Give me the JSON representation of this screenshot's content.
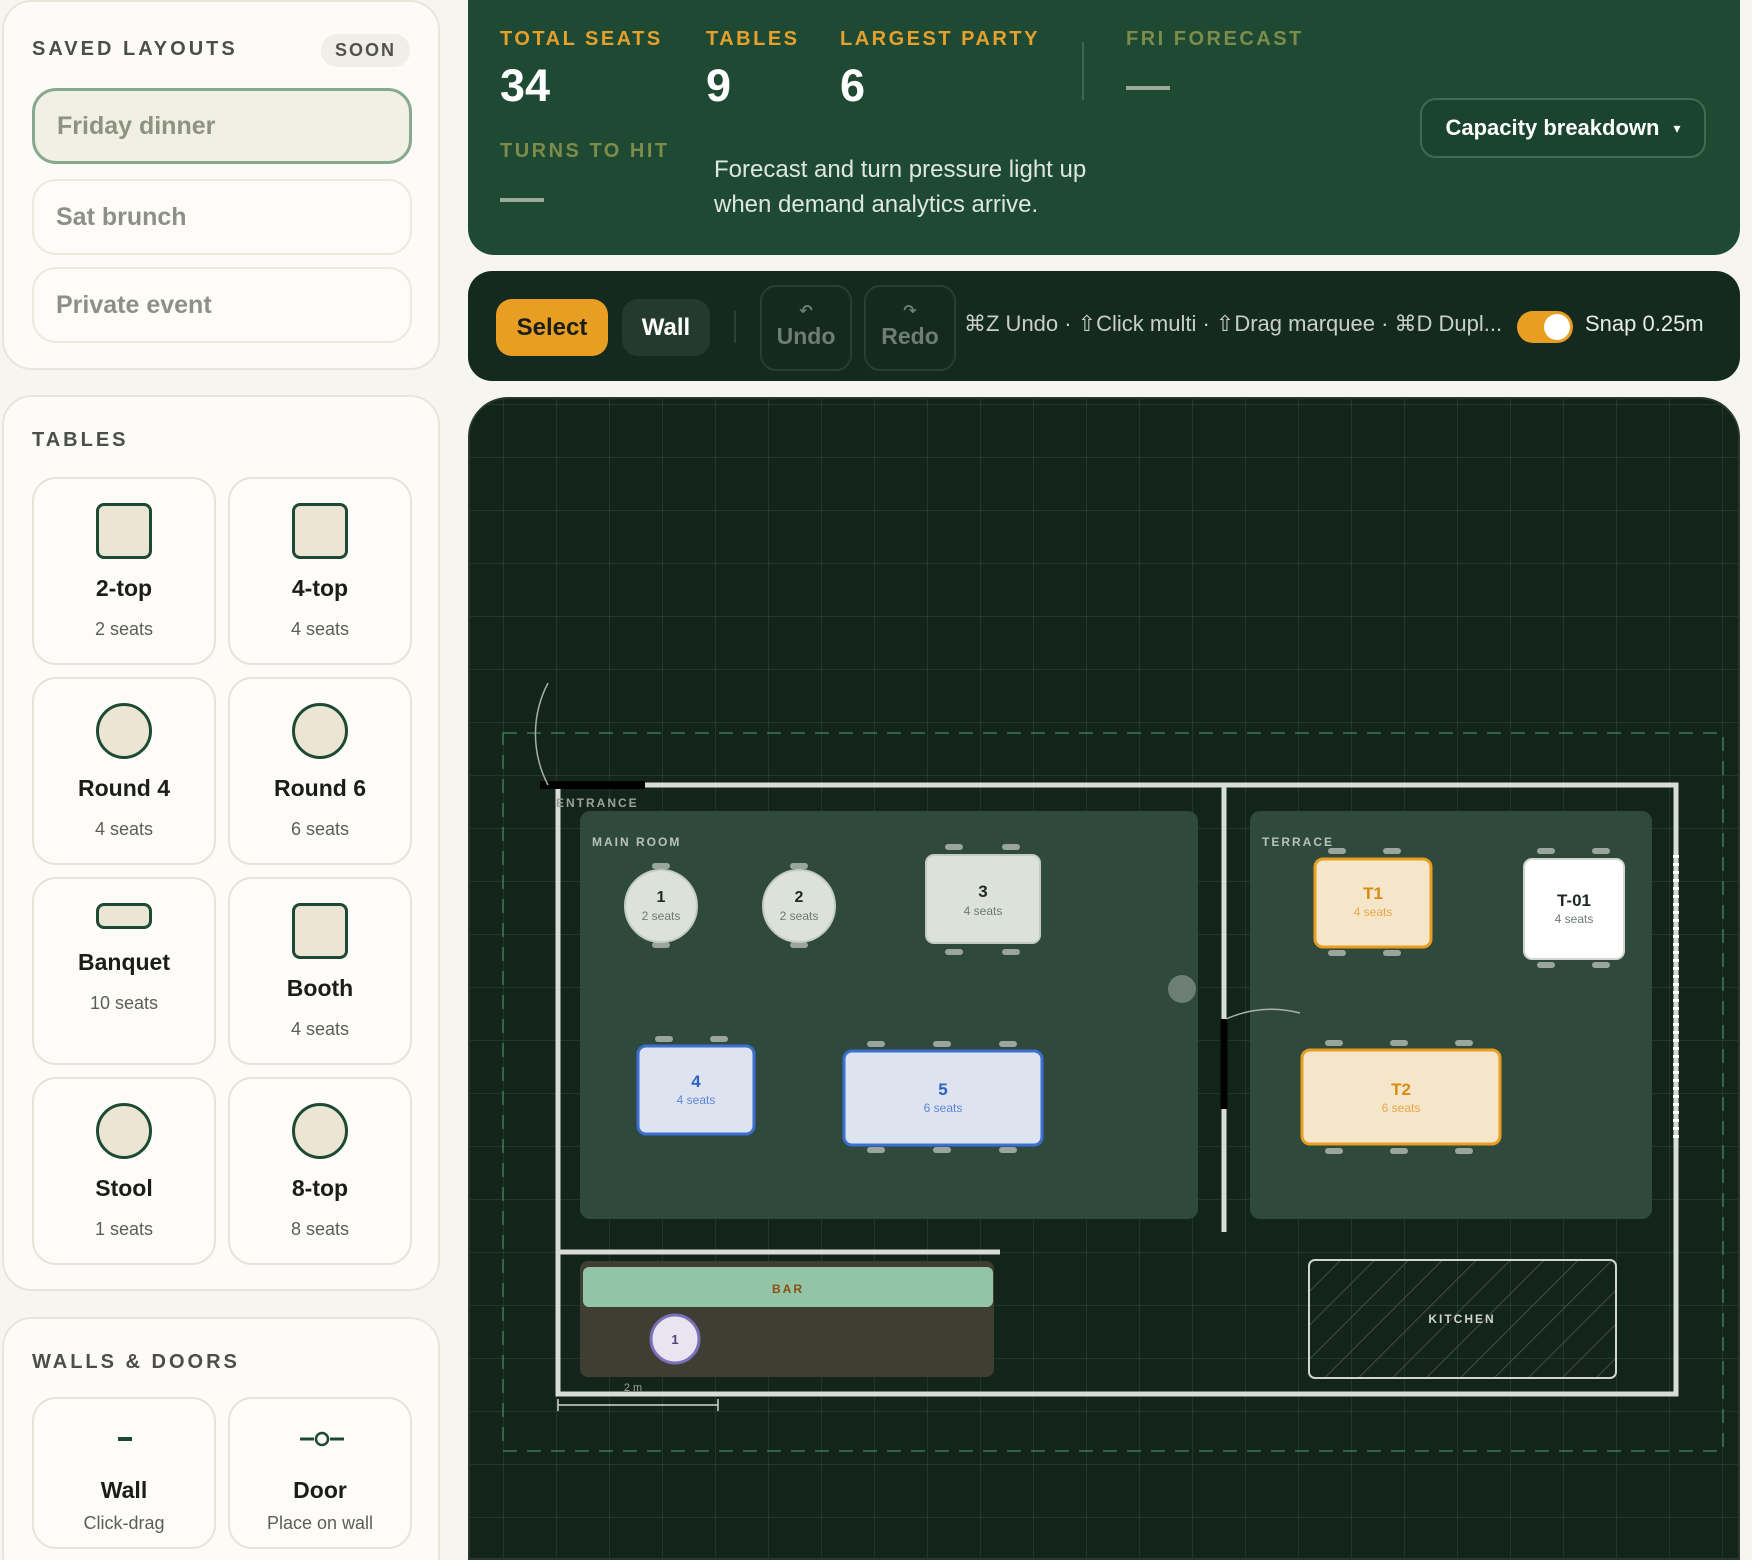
{
  "saved_layouts": {
    "title": "SAVED LAYOUTS",
    "badge": "SOON",
    "items": [
      "Friday dinner",
      "Sat brunch",
      "Private event"
    ]
  },
  "tables_panel": {
    "title": "TABLES",
    "items": [
      {
        "name": "2-top",
        "seats": "2 seats",
        "shape": "square"
      },
      {
        "name": "4-top",
        "seats": "4 seats",
        "shape": "square"
      },
      {
        "name": "Round 4",
        "seats": "4 seats",
        "shape": "round"
      },
      {
        "name": "Round 6",
        "seats": "6 seats",
        "shape": "round"
      },
      {
        "name": "Banquet",
        "seats": "10 seats",
        "shape": "banquet"
      },
      {
        "name": "Booth",
        "seats": "4 seats",
        "shape": "square"
      },
      {
        "name": "Stool",
        "seats": "1 seats",
        "shape": "round"
      },
      {
        "name": "8-top",
        "seats": "8 seats",
        "shape": "round"
      }
    ]
  },
  "walls_panel": {
    "title": "WALLS & DOORS",
    "items": [
      {
        "name": "Wall",
        "sub": "Click-drag",
        "icon": "wall-icon"
      },
      {
        "name": "Door",
        "sub": "Place on wall",
        "icon": "door-icon"
      }
    ]
  },
  "stats": {
    "total_seats_label": "TOTAL SEATS",
    "total_seats": "34",
    "tables_label": "TABLES",
    "tables": "9",
    "largest_party_label": "LARGEST PARTY",
    "largest_party": "6",
    "forecast_label": "FRI FORECAST",
    "turns_label": "TURNS TO HIT",
    "message_line1": "Forecast and turn pressure light up",
    "message_line2": "when demand analytics arrive.",
    "capacity_button": "Capacity breakdown",
    "capacity_caret": "▾"
  },
  "toolbar": {
    "select": "Select",
    "wall": "Wall",
    "undo": "Undo",
    "redo": "Redo",
    "undo_icon": "↶",
    "redo_icon": "↷",
    "hint": "⌘Z Undo · ⇧Click multi · ⇧Drag marquee · ⌘D Dupl...",
    "snap_enabled": true,
    "snap": "Snap 0.25m"
  },
  "floor": {
    "zones": {
      "entrance": "ENTRANCE",
      "main_room": "MAIN ROOM",
      "terrace": "TERRACE",
      "bar": "BAR",
      "kitchen": "KITCHEN"
    },
    "scale_label": "2 m",
    "tables": [
      {
        "label": "1",
        "seats": "2 seats",
        "zone": "main_room",
        "shape": "round",
        "style": "default"
      },
      {
        "label": "2",
        "seats": "2 seats",
        "zone": "main_room",
        "shape": "round",
        "style": "default"
      },
      {
        "label": "3",
        "seats": "4 seats",
        "zone": "main_room",
        "shape": "rect",
        "style": "default"
      },
      {
        "label": "4",
        "seats": "4 seats",
        "zone": "main_room",
        "shape": "rect",
        "style": "blue"
      },
      {
        "label": "5",
        "seats": "6 seats",
        "zone": "main_room",
        "shape": "rect",
        "style": "blue"
      },
      {
        "label": "T1",
        "seats": "4 seats",
        "zone": "terrace",
        "shape": "rect",
        "style": "orange"
      },
      {
        "label": "T-01",
        "seats": "4 seats",
        "zone": "terrace",
        "shape": "rect",
        "style": "white"
      },
      {
        "label": "T2",
        "seats": "6 seats",
        "zone": "terrace",
        "shape": "rect",
        "style": "orange"
      },
      {
        "label": "1",
        "seats": "",
        "zone": "bar",
        "shape": "stool",
        "style": "stool"
      }
    ]
  }
}
